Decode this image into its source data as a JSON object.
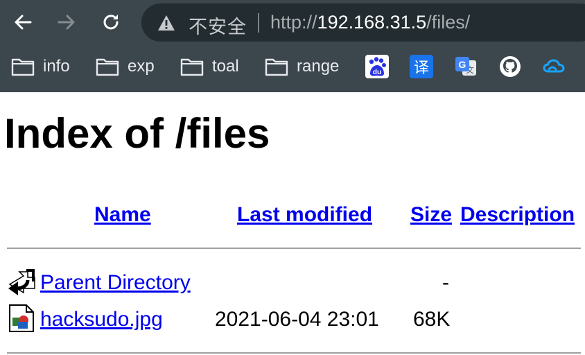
{
  "browser": {
    "security_label": "不安全",
    "url_scheme": "http://",
    "url_host": "192.168.31.5",
    "url_path": "/files/",
    "bookmarks": [
      {
        "label": "info"
      },
      {
        "label": "exp"
      },
      {
        "label": "toal"
      },
      {
        "label": "range"
      }
    ],
    "bookmark_icons": [
      {
        "name": "baidu-icon",
        "glyph": "du",
        "color": "#2932e1"
      },
      {
        "name": "translate-icon",
        "glyph": "译",
        "color": "#1a73e8"
      },
      {
        "name": "google-translate-icon",
        "glyph": "G",
        "color": "#4285f4"
      },
      {
        "name": "github-icon"
      },
      {
        "name": "cloud-icon",
        "color": "#1aa3ff"
      }
    ]
  },
  "page": {
    "title": "Index of /files",
    "columns": {
      "name": "Name",
      "last_modified": "Last modified",
      "size": "Size",
      "description": "Description"
    },
    "rows": [
      {
        "icon": "back-arrow-icon",
        "name": "Parent Directory",
        "last_modified": "",
        "size": "-",
        "description": ""
      },
      {
        "icon": "image-file-icon",
        "name": "hacksudo.jpg",
        "last_modified": "2021-06-04 23:01",
        "size": "68K",
        "description": ""
      }
    ]
  }
}
